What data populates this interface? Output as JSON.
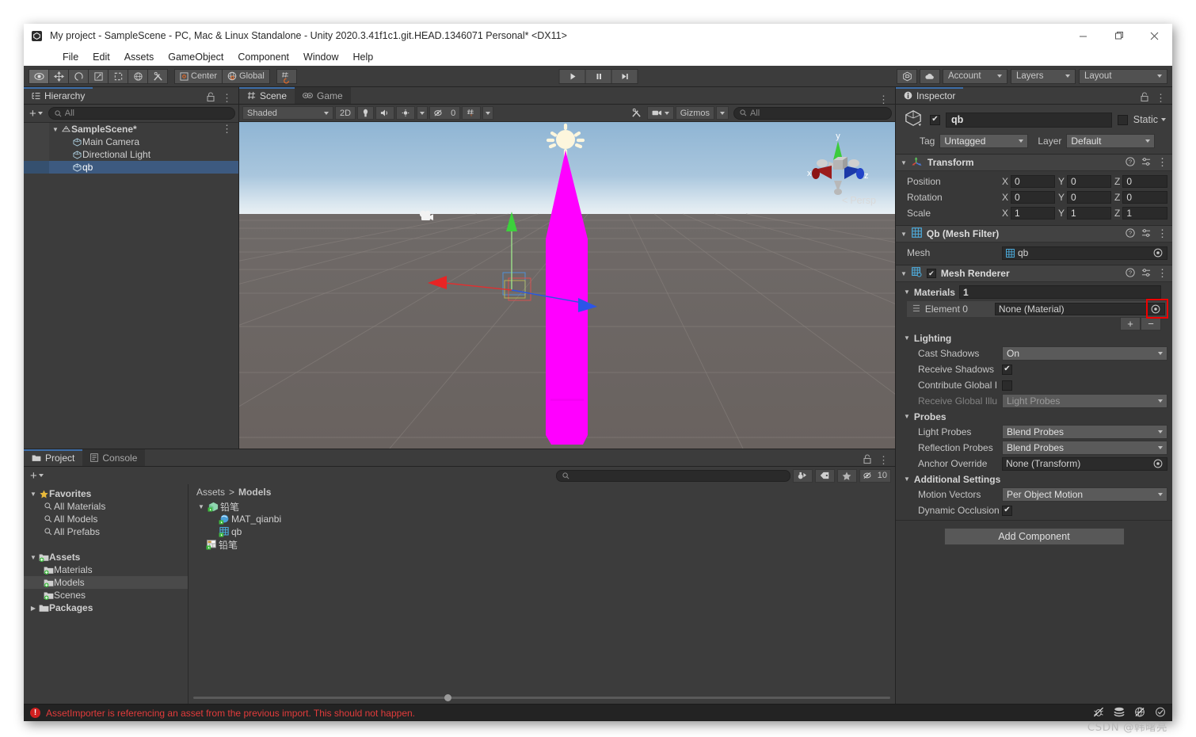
{
  "window": {
    "title": "My project - SampleScene - PC, Mac & Linux Standalone - Unity 2020.3.41f1c1.git.HEAD.1346071 Personal* <DX11>",
    "minimize": "—",
    "maximize": "❐",
    "close": "✕"
  },
  "menubar": {
    "items": [
      "File",
      "Edit",
      "Assets",
      "GameObject",
      "Component",
      "Window",
      "Help"
    ]
  },
  "toolbar": {
    "tools": [
      "hand-tool",
      "move-tool",
      "rotate-tool",
      "scale-tool",
      "rect-tool",
      "transform-tool",
      "custom-tool"
    ],
    "pivot_mode": "Center",
    "pivot_rotation": "Global",
    "snap_label": "",
    "play": "▶",
    "pause": "❚❚",
    "step": "▶|",
    "collab_label": "",
    "cloud_label": "",
    "account": "Account",
    "layers": "Layers",
    "layout": "Layout"
  },
  "hierarchy": {
    "tab": "Hierarchy",
    "search_placeholder": "All",
    "create_label": "+",
    "items": [
      {
        "label": "SampleScene*",
        "depth": 0,
        "icon": "scene-icon",
        "selected": false,
        "expanded": true,
        "bold": true
      },
      {
        "label": "Main Camera",
        "depth": 1,
        "icon": "gameobject-icon",
        "selected": false,
        "expanded": null,
        "bold": false
      },
      {
        "label": "Directional Light",
        "depth": 1,
        "icon": "gameobject-icon",
        "selected": false,
        "expanded": null,
        "bold": false
      },
      {
        "label": "qb",
        "depth": 1,
        "icon": "gameobject-icon",
        "selected": true,
        "expanded": null,
        "bold": false
      }
    ]
  },
  "scene": {
    "tabs": [
      {
        "label": "Scene",
        "icon": "scene-grid-icon",
        "active": true
      },
      {
        "label": "Game",
        "icon": "game-icon",
        "active": false
      }
    ],
    "draw_mode": "Shaded",
    "two_d": "2D",
    "effects_count": "0",
    "gizmos": "Gizmos",
    "search_placeholder": "All",
    "view_label": "Persp",
    "axis_x": "x",
    "axis_y": "y",
    "axis_z": "z"
  },
  "project": {
    "tabs": [
      {
        "label": "Project",
        "icon": "folder-icon",
        "active": true
      },
      {
        "label": "Console",
        "icon": "console-icon",
        "active": false
      }
    ],
    "create_label": "+",
    "search_placeholder": "",
    "hidden_count": "10",
    "breadcrumb": [
      "Assets",
      "Models"
    ],
    "tree": [
      {
        "label": "Favorites",
        "depth": 0,
        "icon": "star-icon",
        "expanded": true,
        "bold": true,
        "selected": false
      },
      {
        "label": "All Materials",
        "depth": 1,
        "icon": "search-icon",
        "expanded": null,
        "bold": false,
        "selected": false
      },
      {
        "label": "All Models",
        "depth": 1,
        "icon": "search-icon",
        "expanded": null,
        "bold": false,
        "selected": false
      },
      {
        "label": "All Prefabs",
        "depth": 1,
        "icon": "search-icon",
        "expanded": null,
        "bold": false,
        "selected": false
      },
      {
        "label": "",
        "depth": 0,
        "icon": "spacer",
        "expanded": null,
        "bold": false,
        "selected": false
      },
      {
        "label": "Assets",
        "depth": 0,
        "icon": "folder-assets-icon",
        "expanded": true,
        "bold": true,
        "selected": false
      },
      {
        "label": "Materials",
        "depth": 1,
        "icon": "folder-assets-icon",
        "expanded": null,
        "bold": false,
        "selected": false
      },
      {
        "label": "Models",
        "depth": 1,
        "icon": "folder-assets-icon",
        "expanded": null,
        "bold": false,
        "selected": true
      },
      {
        "label": "Scenes",
        "depth": 1,
        "icon": "folder-assets-icon",
        "expanded": null,
        "bold": false,
        "selected": false
      },
      {
        "label": "Packages",
        "depth": 0,
        "icon": "folder-icon",
        "expanded": false,
        "bold": true,
        "selected": false
      }
    ],
    "contents": [
      {
        "label": "铅笔",
        "depth": 0,
        "icon": "model-icon",
        "expanded": true
      },
      {
        "label": "MAT_qianbi",
        "depth": 1,
        "icon": "material-icon",
        "expanded": null
      },
      {
        "label": "qb",
        "depth": 1,
        "icon": "mesh-icon",
        "expanded": null
      },
      {
        "label": "铅笔",
        "depth": 0,
        "icon": "texture-icon",
        "expanded": null
      }
    ]
  },
  "inspector": {
    "tab": "Inspector",
    "gameobject": {
      "enabled": true,
      "name": "qb",
      "static_label": "Static",
      "tag_label": "Tag",
      "tag_value": "Untagged",
      "layer_label": "Layer",
      "layer_value": "Default"
    },
    "components": [
      {
        "title": "Transform",
        "icon": "transform-icon",
        "has_checkbox": false,
        "rows": [
          {
            "name": "Position",
            "x": "0",
            "y": "0",
            "z": "0"
          },
          {
            "name": "Rotation",
            "x": "0",
            "y": "0",
            "z": "0"
          },
          {
            "name": "Scale",
            "x": "1",
            "y": "1",
            "z": "1"
          }
        ]
      }
    ],
    "mesh_filter": {
      "title": "Qb (Mesh Filter)",
      "icon": "mesh-filter-icon",
      "mesh_label": "Mesh",
      "mesh_value": "qb"
    },
    "mesh_renderer": {
      "title": "Mesh Renderer",
      "icon": "mesh-renderer-icon",
      "enabled": true,
      "materials_label": "Materials",
      "materials_count": "1",
      "element_label": "Element 0",
      "element_value": "None (Material)",
      "add_btn": "+",
      "remove_btn": "−",
      "lighting_label": "Lighting",
      "cast_shadows_label": "Cast Shadows",
      "cast_shadows_value": "On",
      "receive_shadows_label": "Receive Shadows",
      "receive_shadows_checked": true,
      "contribute_gi_label": "Contribute Global I",
      "contribute_gi_checked": false,
      "receive_gi_label": "Receive Global Illu",
      "receive_gi_value": "Light Probes",
      "probes_label": "Probes",
      "light_probes_label": "Light Probes",
      "light_probes_value": "Blend Probes",
      "reflection_probes_label": "Reflection Probes",
      "reflection_probes_value": "Blend Probes",
      "anchor_override_label": "Anchor Override",
      "anchor_override_value": "None (Transform)",
      "additional_label": "Additional Settings",
      "motion_vectors_label": "Motion Vectors",
      "motion_vectors_value": "Per Object Motion",
      "dynamic_occlusion_label": "Dynamic Occlusion",
      "dynamic_occlusion_checked": true
    },
    "add_component": "Add Component"
  },
  "statusbar": {
    "error": "AssetImporter is referencing an asset from the previous import. This should not happen."
  },
  "watermark": "CSDN @韩曙亮",
  "colors": {
    "accent_selection": "#3d5a80",
    "tab_active_underline": "#3e6ea8",
    "error_red": "#e23b3b",
    "highlight_box": "#ef0000",
    "magenta_model": "#ff00ff",
    "axis_x": "#e03030",
    "axis_y": "#3cd13c",
    "axis_z": "#2a58e0"
  }
}
